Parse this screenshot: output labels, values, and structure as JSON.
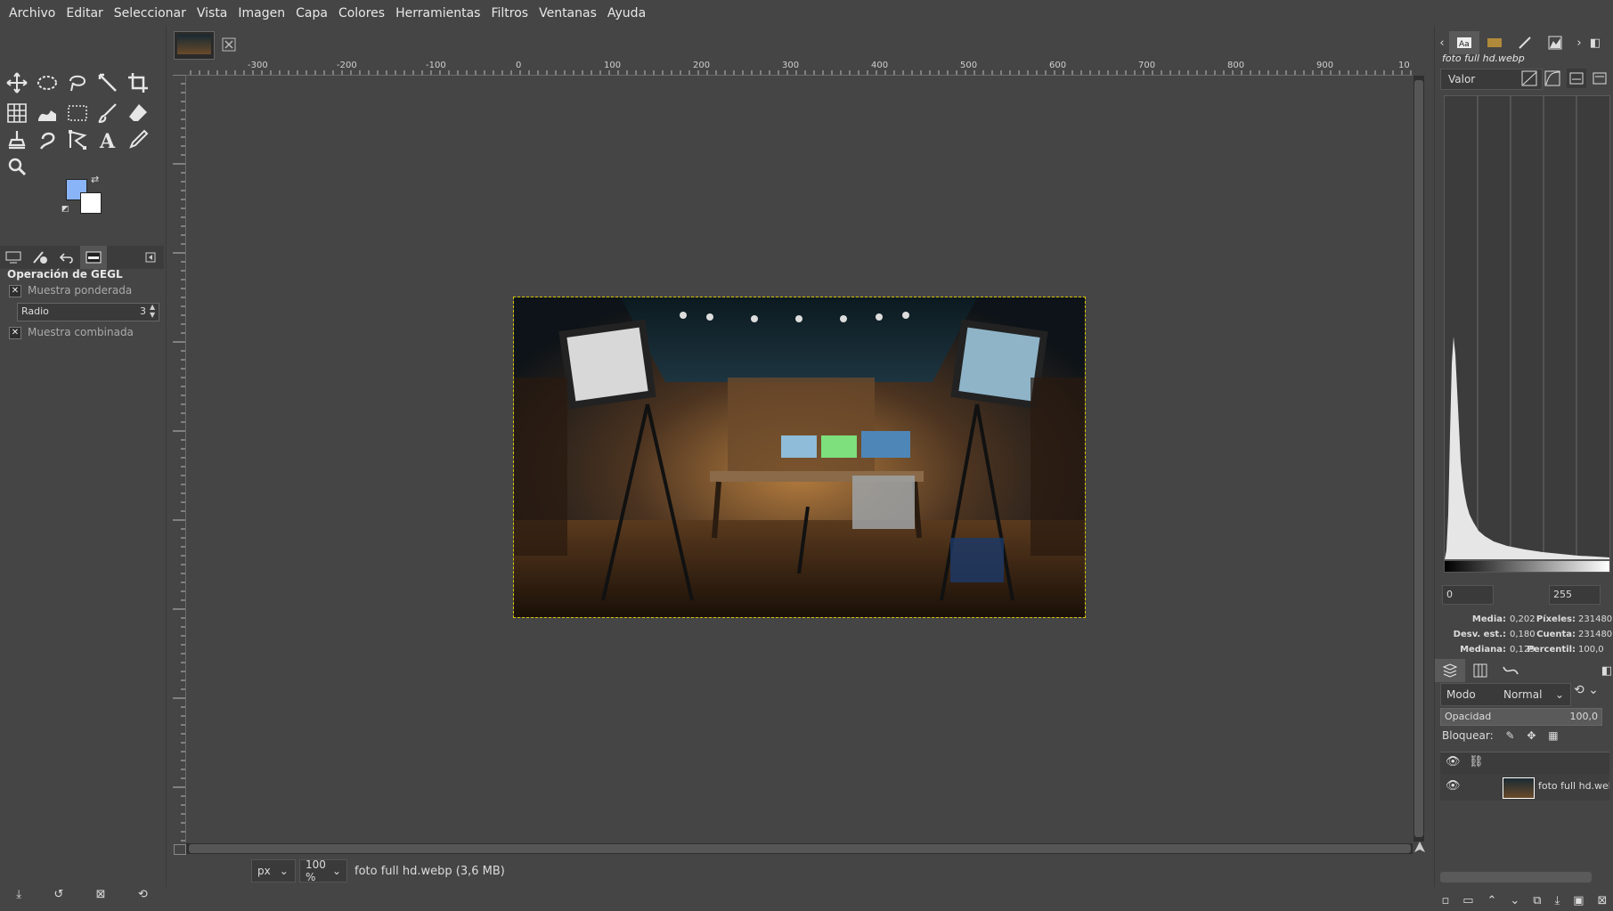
{
  "menubar": [
    "Archivo",
    "Editar",
    "Seleccionar",
    "Vista",
    "Imagen",
    "Capa",
    "Colores",
    "Herramientas",
    "Filtros",
    "Ventanas",
    "Ayuda"
  ],
  "tool_options": {
    "title": "Operación de GEGL",
    "weighted_sample_label": "Muestra ponderada",
    "weighted_sample_checked": "✕",
    "radius_label": "Radio",
    "radius_value": "3",
    "combined_sample_label": "Muestra combinada",
    "combined_sample_checked": "✕"
  },
  "ruler": {
    "h_ticks": [
      "-300",
      "-200",
      "-100",
      "0",
      "100",
      "200",
      "300",
      "400",
      "500",
      "600",
      "700",
      "800",
      "900",
      "10"
    ]
  },
  "statusbar": {
    "unit": "px",
    "zoom": "100 %",
    "info": "foto full hd.webp (3,6 MB)"
  },
  "histogram": {
    "title": "foto full hd.webp",
    "channel": "Valor",
    "range_min": "0",
    "range_max": "255",
    "stats": {
      "mean_label": "Media:",
      "mean": "0,202",
      "stddev_label": "Desv. est.:",
      "stddev": "0,180",
      "median_label": "Mediana:",
      "median": "0,129",
      "pixels_label": "Píxeles:",
      "pixels": "231480",
      "count_label": "Cuenta:",
      "count": "231480",
      "percentile_label": "Percentil:",
      "percentile": "100,0"
    }
  },
  "layers": {
    "mode_label": "Modo",
    "mode_value": "Normal",
    "opacity_label": "Opacidad",
    "opacity_value": "100,0",
    "lock_label": "Bloquear:",
    "layer_name": "foto full hd.webp"
  },
  "colors": {
    "foreground": "#8ab4f8",
    "background": "#ffffff",
    "selection_border": "#d8c400"
  }
}
